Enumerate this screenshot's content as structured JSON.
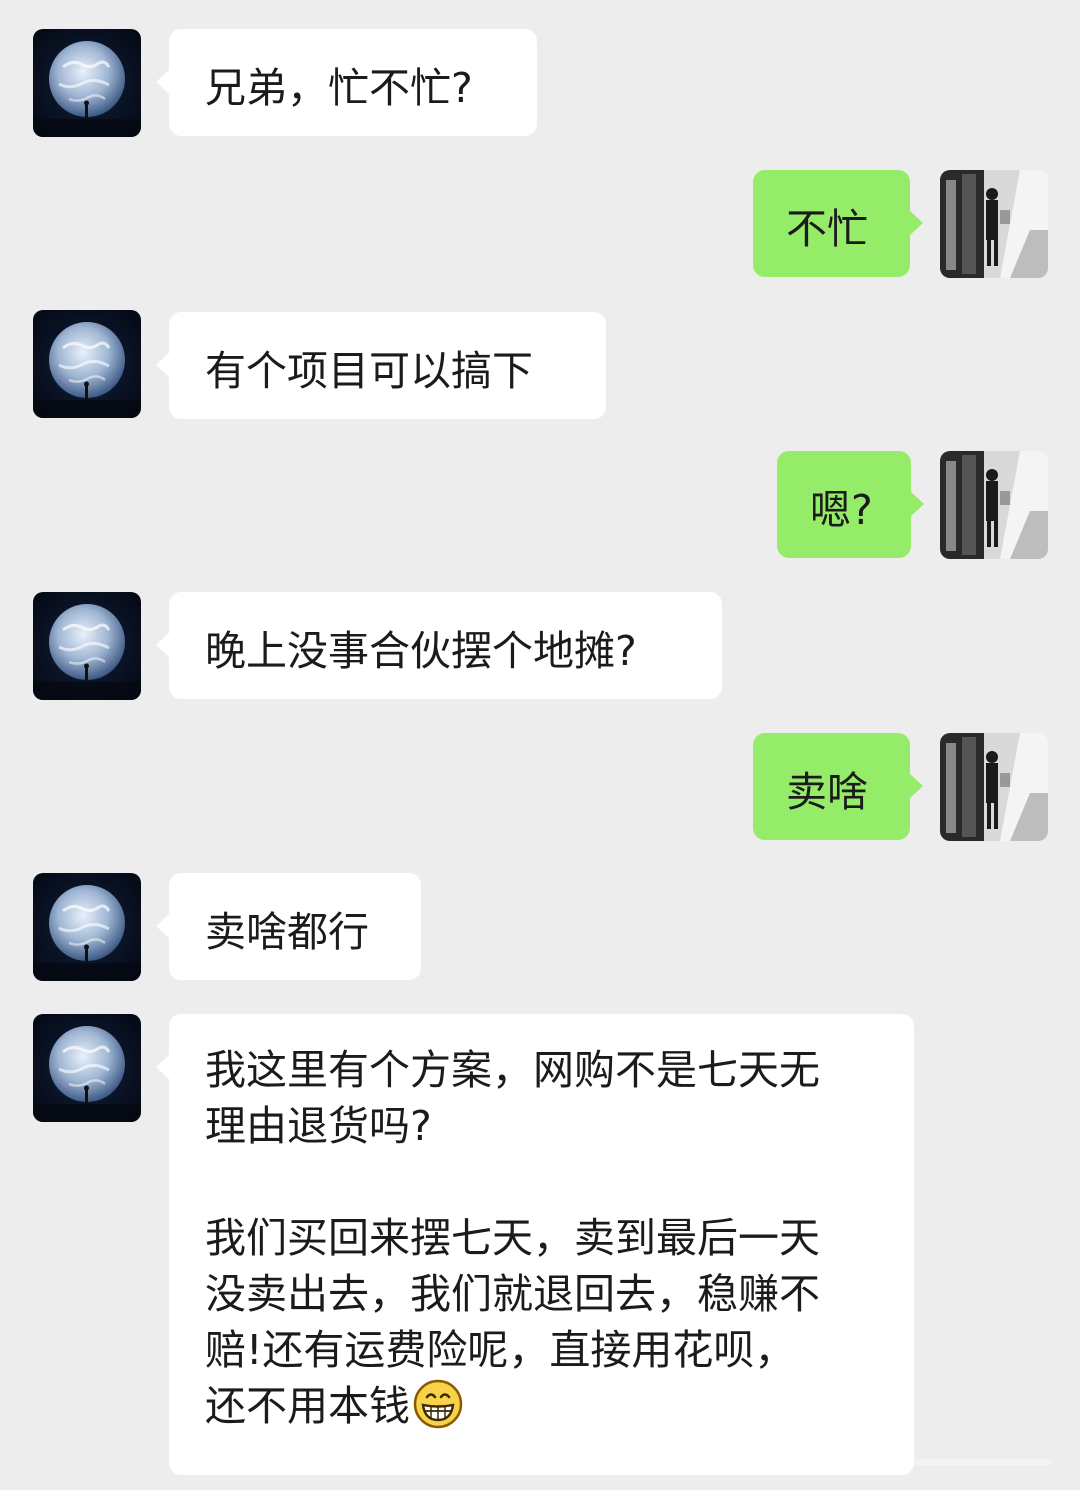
{
  "chat": {
    "messages": [
      {
        "id": "m1",
        "side": "left",
        "text": "兄弟，忙不忙?",
        "avatar": "earth-avatar-icon"
      },
      {
        "id": "m2",
        "side": "right",
        "text": "不忙",
        "avatar": "photo-avatar-icon"
      },
      {
        "id": "m3",
        "side": "left",
        "text": "有个项目可以搞下",
        "avatar": "earth-avatar-icon"
      },
      {
        "id": "m4",
        "side": "right",
        "text": "嗯?",
        "avatar": "photo-avatar-icon"
      },
      {
        "id": "m5",
        "side": "left",
        "text": "晚上没事合伙摆个地摊?",
        "avatar": "earth-avatar-icon"
      },
      {
        "id": "m6",
        "side": "right",
        "text": "卖啥",
        "avatar": "photo-avatar-icon"
      },
      {
        "id": "m7",
        "side": "left",
        "text": "卖啥都行",
        "avatar": "earth-avatar-icon"
      },
      {
        "id": "m8",
        "side": "left",
        "avatar": "earth-avatar-icon",
        "lines": [
          "我这里有个方案，网购不是七天无",
          "理由退货吗?",
          "",
          "我们买回来摆七天，卖到最后一天",
          "没卖出去，我们就退回去，稳赚不",
          "赔!还有运费险呢，直接用花呗，",
          "还不用本钱"
        ],
        "trailing_emoji": "grinning-face-icon"
      }
    ]
  },
  "colors": {
    "background": "#ededed",
    "bubble_left": "#ffffff",
    "bubble_right": "#95ec69",
    "text": "#1b1b1b"
  }
}
